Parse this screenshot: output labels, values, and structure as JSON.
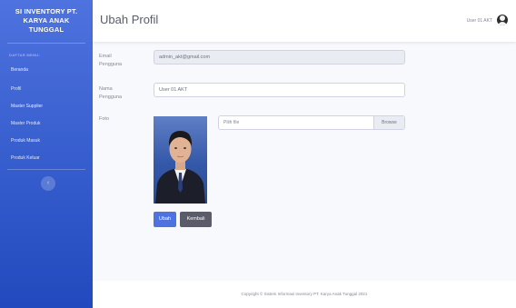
{
  "sidebar": {
    "brand_line1": "SI INVENTORY PT.",
    "brand_line2": "KARYA ANAK",
    "brand_line3": "TUNGGAL",
    "menu_heading": "DAFTAR MENU:",
    "items": [
      {
        "label": "Beranda"
      },
      {
        "label": "Profil"
      },
      {
        "label": "Master Supplier"
      },
      {
        "label": "Master Produk"
      },
      {
        "label": "Produk Masuk"
      },
      {
        "label": "Produk Keluar"
      }
    ],
    "toggle_icon": "chevron-left-icon",
    "toggle_glyph": "‹"
  },
  "topbar": {
    "title": "Ubah Profil",
    "user_name": "User 01 AKT",
    "avatar_icon": "user-avatar-icon"
  },
  "form": {
    "email_label_line1": "Email",
    "email_label_line2": "Pengguna",
    "email_value": "admin_akt@gmail.com",
    "name_label_line1": "Nama",
    "name_label_line2": "Pengguna",
    "name_value": "User 01 AKT",
    "photo_label": "Foto",
    "file_placeholder": "Pilih file",
    "browse_label": "Browse",
    "save_label": "Ubah",
    "back_label": "Kembali"
  },
  "footer": {
    "copyright": "Copyright © Sistem Informasi Inventory PT. Karya Anak Tunggal 2021"
  },
  "colors": {
    "sidebar_top": "#4e73df",
    "sidebar_bottom": "#224abe",
    "primary_button": "#4e73df",
    "secondary_button": "#5a5c69",
    "page_background": "#f8f9fc"
  }
}
